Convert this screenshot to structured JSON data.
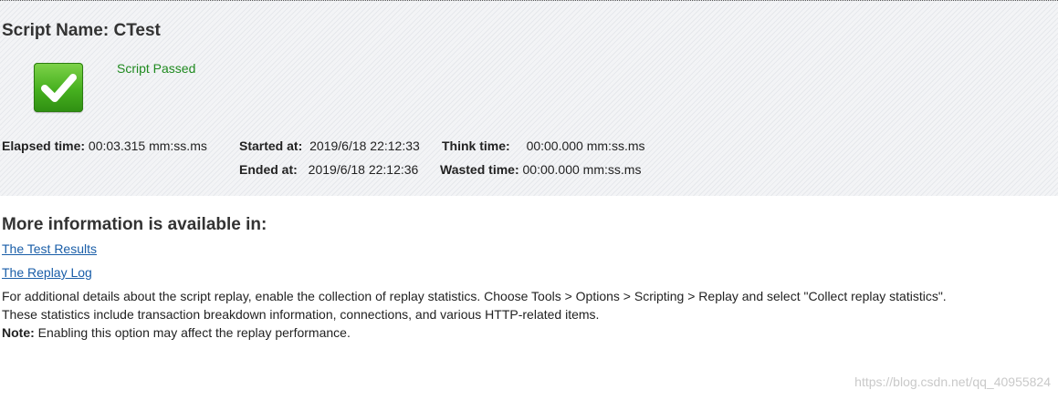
{
  "script": {
    "title": "Script Name: CTest",
    "status_text": "Script Passed",
    "status_icon": "checkmark-icon",
    "status_color": "#1f8a1f"
  },
  "stats": {
    "elapsed_label": "Elapsed time:",
    "elapsed_value": "00:03.315 mm:ss.ms",
    "started_label": "Started at:",
    "started_value": "2019/6/18 22:12:33",
    "ended_label": "Ended at:",
    "ended_value": "2019/6/18 22:12:36",
    "think_label": "Think time:",
    "think_value": "00:00.000 mm:ss.ms",
    "wasted_label": "Wasted time:",
    "wasted_value": "00:00.000 mm:ss.ms"
  },
  "more_info": {
    "heading": "More information is available in:",
    "links": [
      "The Test Results",
      "The Replay Log"
    ],
    "paragraph_line1": "For additional details about the script replay, enable the collection of replay statistics. Choose Tools > Options > Scripting > Replay and select \"Collect replay statistics\".",
    "paragraph_line2": "These statistics include transaction breakdown information, connections, and various HTTP-related items.",
    "note_label": "Note:",
    "note_text": " Enabling this option may affect the replay performance."
  },
  "watermark": "https://blog.csdn.net/qq_40955824",
  "colors": {
    "link": "#1a5ea8",
    "pass_green": "#46b01f"
  }
}
